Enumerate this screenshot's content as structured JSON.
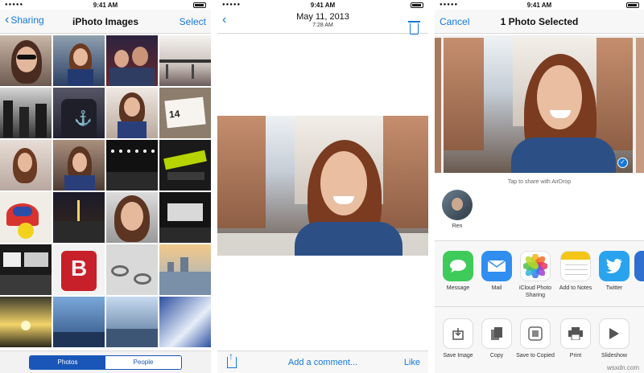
{
  "screen1": {
    "time": "9:41 AM",
    "back_label": "Sharing",
    "title": "iPhoto Images",
    "select_label": "Select",
    "segments": [
      {
        "label": "Photos",
        "selected": true
      },
      {
        "label": "People",
        "selected": false
      }
    ]
  },
  "screen2": {
    "time": "9:41 AM",
    "date": "May 11, 2013",
    "time_taken": "7:28 AM",
    "comment_placeholder": "Add a comment...",
    "like_label": "Like"
  },
  "screen3": {
    "time": "9:41 AM",
    "cancel_label": "Cancel",
    "title": "1 Photo Selected",
    "airdrop_hint": "Tap to share with AirDrop",
    "contact_name": "Ren",
    "apps": [
      {
        "label": "Message",
        "icon": "message-icon",
        "color": "#3ecb5a"
      },
      {
        "label": "Mail",
        "icon": "mail-icon",
        "color": "#2f8ef0"
      },
      {
        "label": "iCloud Photo Sharing",
        "icon": "photos-icon",
        "color": "#ffffff"
      },
      {
        "label": "Add to Notes",
        "icon": "notes-icon",
        "color": "#ffffff"
      },
      {
        "label": "Twitter",
        "icon": "twitter-icon",
        "color": "#2aa3ef"
      }
    ],
    "actions": [
      {
        "label": "Save Image",
        "icon": "save-image-icon"
      },
      {
        "label": "Copy",
        "icon": "copy-icon"
      },
      {
        "label": "Save to Copied",
        "icon": "copied-icon"
      },
      {
        "label": "Print",
        "icon": "print-icon"
      },
      {
        "label": "Slideshow",
        "icon": "slideshow-icon"
      }
    ]
  },
  "watermark": "wsxdn.com"
}
